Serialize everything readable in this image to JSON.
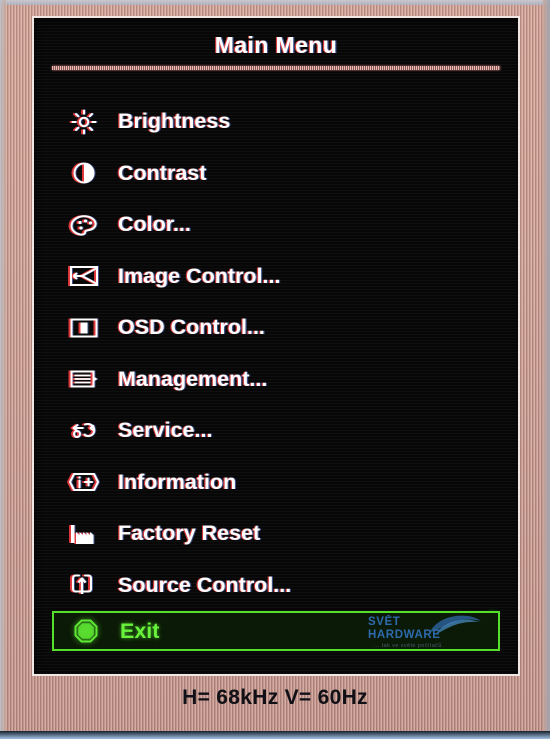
{
  "osd": {
    "title": "Main Menu",
    "items": [
      {
        "label": "Brightness",
        "icon": "brightness-sun-icon",
        "selected": false
      },
      {
        "label": "Contrast",
        "icon": "contrast-half-circle-icon",
        "selected": false
      },
      {
        "label": "Color...",
        "icon": "color-palette-icon",
        "selected": false
      },
      {
        "label": "Image Control...",
        "icon": "image-control-icon",
        "selected": false
      },
      {
        "label": "OSD Control...",
        "icon": "osd-control-icon",
        "selected": false
      },
      {
        "label": "Management...",
        "icon": "management-icon",
        "selected": false
      },
      {
        "label": "Service...",
        "icon": "service-wrench-icon",
        "selected": false
      },
      {
        "label": "Information",
        "icon": "information-icon",
        "selected": false
      },
      {
        "label": "Factory Reset",
        "icon": "factory-reset-icon",
        "selected": false
      },
      {
        "label": "Source Control...",
        "icon": "source-control-icon",
        "selected": false
      },
      {
        "label": "Exit",
        "icon": "exit-octagon-icon",
        "selected": true
      }
    ],
    "cursor_icon": "left-triangle-cursor-icon",
    "selected_index": 10
  },
  "watermark": {
    "line1": "SVĚT",
    "line2": "HARDWARE",
    "tagline": "... tak ve světe počítačů",
    "swoosh_icon": "swoosh-icon"
  },
  "status_bar": {
    "text": "H= 68kHz  V= 60Hz",
    "h_freq": "H= 68kHz",
    "v_freq": "V= 60Hz"
  },
  "colors": {
    "osd_text": "#fdfdfd",
    "osd_background": "#070707",
    "highlight_green": "#68f23c",
    "highlight_border": "#55e02a",
    "bezel": "#d2a193",
    "watermark_blue": "#2f6fb5",
    "status_text": "#101016"
  }
}
